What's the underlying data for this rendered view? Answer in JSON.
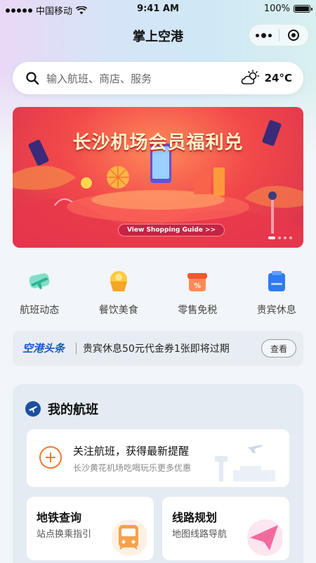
{
  "status_bar": {
    "carrier": "中国移动",
    "time": "9:41 AM",
    "battery": "100%"
  },
  "nav": {
    "title": "掌上空港"
  },
  "search": {
    "placeholder": "输入航班、商店、服务",
    "weather_icon": "partly-cloudy-icon",
    "temperature": "24°C"
  },
  "banner": {
    "title": "长沙机场会员福利兑",
    "button": "View Shopping Guide >>",
    "slide_count": 4,
    "active_slide": 1
  },
  "quick_nav": [
    {
      "label": "航班动态",
      "icon": "plane-icon",
      "color": "#3cc6a7"
    },
    {
      "label": "餐饮美食",
      "icon": "food-icon",
      "color": "#f5a623"
    },
    {
      "label": "零售免税",
      "icon": "shop-icon",
      "color": "#f06b3a"
    },
    {
      "label": "贵宾休息",
      "icon": "vip-icon",
      "color": "#2f7bf0"
    }
  ],
  "news": {
    "tag": "空港头条",
    "text": "贵宾休息50元代金券1张即将过期",
    "button": "查看"
  },
  "flights": {
    "title": "我的航班",
    "follow": {
      "title": "关注航班，获得最新提醒",
      "subtitle": "长沙黄花机场吃喝玩乐更多优惠"
    },
    "metro": {
      "title": "地铁查询",
      "subtitle": "站点换乘指引"
    },
    "route": {
      "title": "线路规划",
      "subtitle": "地图线路导航"
    }
  },
  "colors": {
    "accent_blue": "#1c5bbd",
    "accent_orange": "#f07a2a",
    "banner_red": "#f2494a"
  }
}
